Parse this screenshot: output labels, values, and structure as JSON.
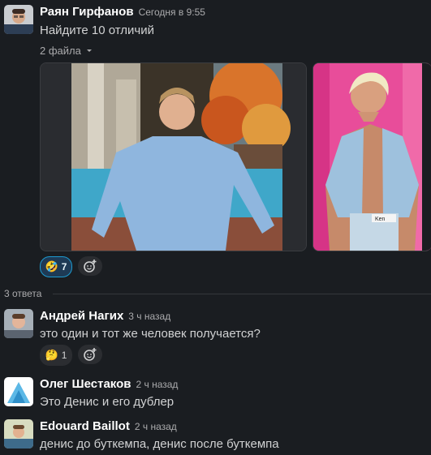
{
  "thread": {
    "parent": {
      "author": "Раян Гирфанов",
      "time": "Сегодня в 9:55",
      "text": "Найдите 10 отличий",
      "files_label": "2 файла",
      "reactions": [
        {
          "emoji": "🤣",
          "count": "7"
        }
      ]
    },
    "replies_label": "3 ответа",
    "replies": [
      {
        "author": "Андрей Нагих",
        "time": "3 ч назад",
        "text": "это один и тот же человек получается?",
        "reactions": [
          {
            "emoji": "🤔",
            "count": "1"
          }
        ]
      },
      {
        "author": "Олег Шестаков",
        "time": "2 ч назад",
        "text": "Это Денис и его дублер"
      },
      {
        "author": "Edouard Baillot",
        "time": "2 ч назад",
        "text": "денис до буткемпа, денис после буткемпа"
      }
    ]
  },
  "colors": {
    "background": "#1a1d21",
    "reaction_active_border": "#1d9bd1",
    "barbie_pink": "#e84d9a"
  },
  "images": {
    "image1_label": "Ken"
  }
}
